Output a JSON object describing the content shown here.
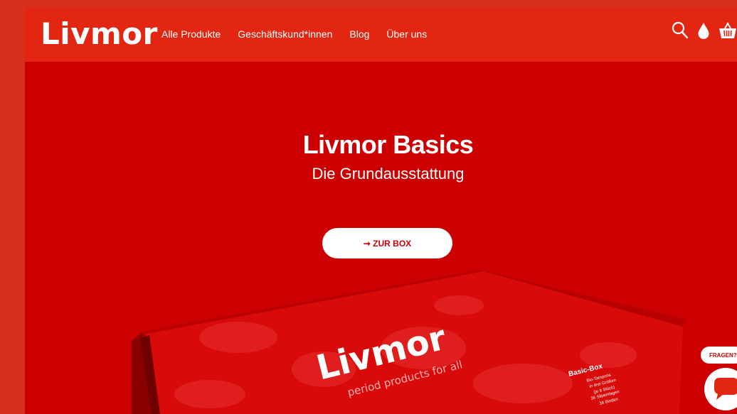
{
  "brand": {
    "logo_text": "Livmor",
    "accent": "#e32612",
    "hero_bg": "#cc0000"
  },
  "nav": {
    "items": [
      {
        "label": "Alle Produkte"
      },
      {
        "label": "Geschäftskund*innen"
      },
      {
        "label": "Blog"
      },
      {
        "label": "Über uns"
      }
    ]
  },
  "header_icons": [
    "search-icon",
    "drop-icon",
    "basket-icon"
  ],
  "hero": {
    "title": "Livmor Basics",
    "subtitle": "Die Grundausstattung",
    "cta_label": "➞ ZUR BOX"
  },
  "product_box": {
    "logo_text": "Livmor",
    "tagline": "period products for all",
    "side_title": "Basic-Box",
    "side_lines": [
      "Bio-Tampons",
      "in drei Größen",
      "(je 8 Stück)",
      "36 Slipeinlagen",
      "36 Binden"
    ]
  },
  "support": {
    "fragen_label": "FRAGEN?"
  }
}
